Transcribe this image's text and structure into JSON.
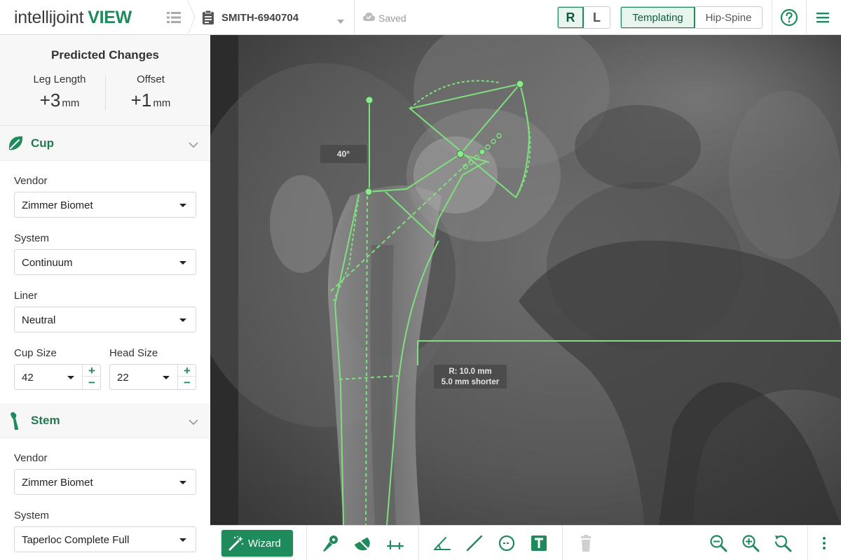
{
  "app": {
    "logo_light": "intellijoint",
    "logo_bold": "VIEW",
    "case_name": "SMITH-6940704",
    "save_status": "Saved"
  },
  "header": {
    "side_right": "R",
    "side_left": "L",
    "mode_templating": "Templating",
    "mode_hip_spine": "Hip-Spine",
    "selected_side": "R",
    "selected_mode": "Templating"
  },
  "predicted": {
    "title": "Predicted Changes",
    "leg_length_label": "Leg Length",
    "leg_length_value": "+3",
    "leg_length_unit": "mm",
    "offset_label": "Offset",
    "offset_value": "+1",
    "offset_unit": "mm"
  },
  "cup": {
    "title": "Cup",
    "vendor_label": "Vendor",
    "vendor": "Zimmer Biomet",
    "system_label": "System",
    "system": "Continuum",
    "liner_label": "Liner",
    "liner": "Neutral",
    "cup_size_label": "Cup Size",
    "cup_size": "42",
    "head_size_label": "Head Size",
    "head_size": "22"
  },
  "stem": {
    "title": "Stem",
    "vendor_label": "Vendor",
    "vendor": "Zimmer Biomet",
    "system_label": "System",
    "system": "Taperloc Complete Full"
  },
  "overlay": {
    "angle_label": "40°",
    "measure_line1": "R: 10.0 mm",
    "measure_line2": "5.0 mm shorter"
  },
  "toolbar": {
    "wizard_label": "Wizard"
  },
  "colors": {
    "brand_green": "#1f8a5c",
    "template_green": "#7ee07e"
  },
  "icons": [
    "list-icon",
    "clipboard-icon",
    "chevron-down-icon",
    "cloud-icon",
    "help-icon",
    "hamburger-menu-icon",
    "leaf-cup-icon",
    "stem-icon",
    "magic-wand-icon",
    "implant-stem-icon",
    "cup-implant-icon",
    "leg-length-icon",
    "angle-icon",
    "line-icon",
    "circle-icon",
    "text-icon",
    "trash-icon",
    "zoom-out-icon",
    "zoom-in-icon",
    "zoom-reset-icon",
    "more-vert-icon"
  ]
}
